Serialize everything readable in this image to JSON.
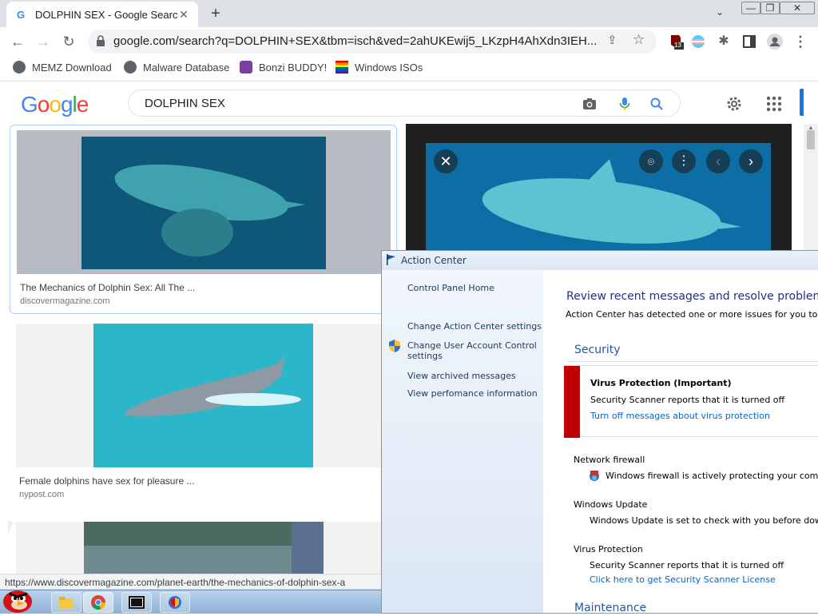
{
  "browser": {
    "tab_title": "DOLPHIN SEX - Google Search",
    "tab_favicon": "G",
    "url": "google.com/search?q=DOLPHIN+SEX&tbm=isch&ved=2ahUKEwij5_LKzpH4AhXdn3IEH...",
    "extension_badge": "13",
    "bookmarks": [
      {
        "label": "MEMZ Download"
      },
      {
        "label": "Malware Database"
      },
      {
        "label": "Bonzi BUDDY!"
      },
      {
        "label": "Windows ISOs"
      }
    ]
  },
  "google": {
    "logo": [
      "G",
      "o",
      "o",
      "g",
      "l",
      "e"
    ],
    "logo_colors": [
      "#4285f4",
      "#ea4335",
      "#fbbc05",
      "#4285f4",
      "#34a853",
      "#ea4335"
    ],
    "query": "DOLPHIN SEX"
  },
  "results": [
    {
      "title": "The Mechanics of Dolphin Sex: All The ...",
      "source": "discovermagazine.com"
    },
    {
      "title": "Female dolphins have sex for pleasure ...",
      "source": "nypost.com"
    }
  ],
  "status_url": "https://www.discovermagazine.com/planet-earth/the-mechanics-of-dolphin-sex-a",
  "action_center": {
    "title": "Action Center",
    "left_links": [
      "Control Panel Home",
      "Change Action Center settings",
      "Change User Account Control settings",
      "View archived messages",
      "View perfomance information"
    ],
    "heading": "Review recent messages and resolve problems",
    "subheading": "Action Center has detected one or more issues for you to revie",
    "security_label": "Security",
    "alert": {
      "title": "Virus Protection (Important)",
      "text": "Security Scanner reports that it is turned off",
      "link": "Turn off messages about virus protection"
    },
    "firewall": {
      "label": "Network firewall",
      "text": "Windows firewall is actively protecting your compute"
    },
    "update": {
      "label": "Windows Update",
      "text": "Windows Update is set to check with you before downloa"
    },
    "virus": {
      "label": "Virus Protection",
      "text": "Security Scanner reports that it is turned off",
      "link": "Click here to get Security Scanner License"
    },
    "maintenance_label": "Maintenance"
  },
  "colors": {
    "accent": "#1a73e8",
    "alert_red": "#c00000"
  }
}
